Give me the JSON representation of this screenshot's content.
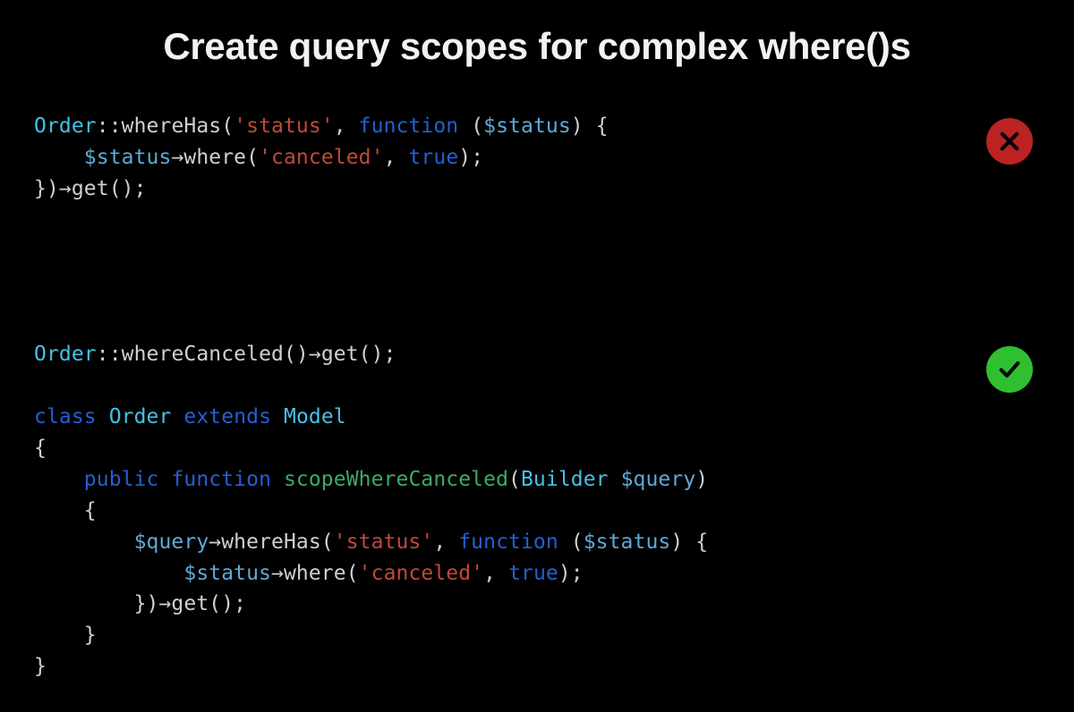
{
  "title": "Create query scopes for complex where()s",
  "badges": {
    "bad": "cross-icon",
    "good": "check-icon"
  },
  "bad": {
    "lines": [
      [
        {
          "cls": "tk-class",
          "t": "Order"
        },
        {
          "cls": "tk-default",
          "t": "::"
        },
        {
          "cls": "tk-call",
          "t": "whereHas"
        },
        {
          "cls": "tk-default",
          "t": "("
        },
        {
          "cls": "tk-string",
          "t": "'status'"
        },
        {
          "cls": "tk-default",
          "t": ", "
        },
        {
          "cls": "tk-keyword",
          "t": "function"
        },
        {
          "cls": "tk-default",
          "t": " ("
        },
        {
          "cls": "tk-var",
          "t": "$status"
        },
        {
          "cls": "tk-default",
          "t": ") {"
        }
      ],
      [
        {
          "cls": "tk-default",
          "t": "    "
        },
        {
          "cls": "tk-var",
          "t": "$status"
        },
        {
          "cls": "tk-default",
          "t": "→"
        },
        {
          "cls": "tk-call",
          "t": "where"
        },
        {
          "cls": "tk-default",
          "t": "("
        },
        {
          "cls": "tk-string",
          "t": "'canceled'"
        },
        {
          "cls": "tk-default",
          "t": ", "
        },
        {
          "cls": "tk-bool",
          "t": "true"
        },
        {
          "cls": "tk-default",
          "t": ");"
        }
      ],
      [
        {
          "cls": "tk-default",
          "t": "})→"
        },
        {
          "cls": "tk-call",
          "t": "get"
        },
        {
          "cls": "tk-default",
          "t": "();"
        }
      ]
    ]
  },
  "good": {
    "lines": [
      [
        {
          "cls": "tk-class",
          "t": "Order"
        },
        {
          "cls": "tk-default",
          "t": "::"
        },
        {
          "cls": "tk-call",
          "t": "whereCanceled"
        },
        {
          "cls": "tk-default",
          "t": "()→"
        },
        {
          "cls": "tk-call",
          "t": "get"
        },
        {
          "cls": "tk-default",
          "t": "();"
        }
      ],
      [
        {
          "cls": "tk-default",
          "t": " "
        }
      ],
      [
        {
          "cls": "tk-keyword",
          "t": "class"
        },
        {
          "cls": "tk-default",
          "t": " "
        },
        {
          "cls": "tk-class",
          "t": "Order"
        },
        {
          "cls": "tk-default",
          "t": " "
        },
        {
          "cls": "tk-keyword",
          "t": "extends"
        },
        {
          "cls": "tk-default",
          "t": " "
        },
        {
          "cls": "tk-class",
          "t": "Model"
        }
      ],
      [
        {
          "cls": "tk-default",
          "t": "{"
        }
      ],
      [
        {
          "cls": "tk-default",
          "t": "    "
        },
        {
          "cls": "tk-keyword",
          "t": "public"
        },
        {
          "cls": "tk-default",
          "t": " "
        },
        {
          "cls": "tk-keyword",
          "t": "function"
        },
        {
          "cls": "tk-default",
          "t": " "
        },
        {
          "cls": "tk-decl",
          "t": "scopeWhereCanceled"
        },
        {
          "cls": "tk-default",
          "t": "("
        },
        {
          "cls": "tk-class",
          "t": "Builder"
        },
        {
          "cls": "tk-default",
          "t": " "
        },
        {
          "cls": "tk-var",
          "t": "$query"
        },
        {
          "cls": "tk-default",
          "t": ")"
        }
      ],
      [
        {
          "cls": "tk-default",
          "t": "    {"
        }
      ],
      [
        {
          "cls": "tk-default",
          "t": "        "
        },
        {
          "cls": "tk-var",
          "t": "$query"
        },
        {
          "cls": "tk-default",
          "t": "→"
        },
        {
          "cls": "tk-call",
          "t": "whereHas"
        },
        {
          "cls": "tk-default",
          "t": "("
        },
        {
          "cls": "tk-string",
          "t": "'status'"
        },
        {
          "cls": "tk-default",
          "t": ", "
        },
        {
          "cls": "tk-keyword",
          "t": "function"
        },
        {
          "cls": "tk-default",
          "t": " ("
        },
        {
          "cls": "tk-var",
          "t": "$status"
        },
        {
          "cls": "tk-default",
          "t": ") {"
        }
      ],
      [
        {
          "cls": "tk-default",
          "t": "            "
        },
        {
          "cls": "tk-var",
          "t": "$status"
        },
        {
          "cls": "tk-default",
          "t": "→"
        },
        {
          "cls": "tk-call",
          "t": "where"
        },
        {
          "cls": "tk-default",
          "t": "("
        },
        {
          "cls": "tk-string",
          "t": "'canceled'"
        },
        {
          "cls": "tk-default",
          "t": ", "
        },
        {
          "cls": "tk-bool",
          "t": "true"
        },
        {
          "cls": "tk-default",
          "t": ");"
        }
      ],
      [
        {
          "cls": "tk-default",
          "t": "        })→"
        },
        {
          "cls": "tk-call",
          "t": "get"
        },
        {
          "cls": "tk-default",
          "t": "();"
        }
      ],
      [
        {
          "cls": "tk-default",
          "t": "    }"
        }
      ],
      [
        {
          "cls": "tk-default",
          "t": "}"
        }
      ]
    ]
  }
}
